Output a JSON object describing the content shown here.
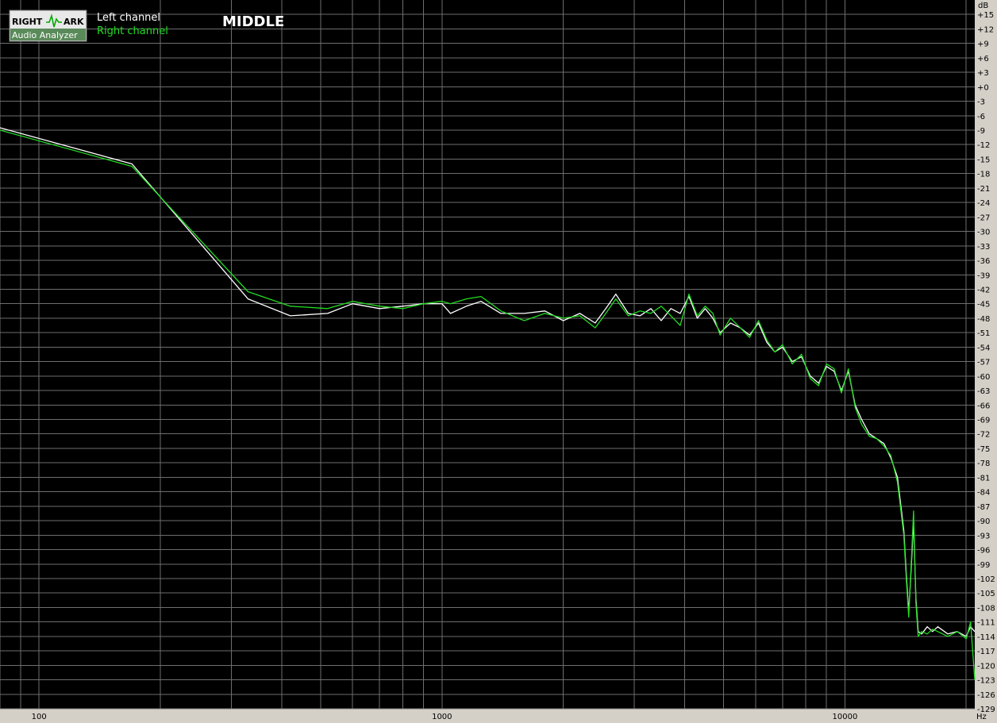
{
  "logo": {
    "word1": "RIGHT",
    "word2": "ARK",
    "subtitle": "Audio Analyzer"
  },
  "chart_data": {
    "type": "line",
    "title": "MIDDLE",
    "xlabel": "Hz",
    "ylabel": "dB",
    "x_scale": "log",
    "xlim": [
      80,
      21000
    ],
    "ylim": [
      -129,
      18
    ],
    "grid": true,
    "legend_position": "top-left",
    "x_tick_labels": [
      {
        "value": 100,
        "label": "100"
      },
      {
        "value": 1000,
        "label": "1000"
      },
      {
        "value": 10000,
        "label": "10000"
      }
    ],
    "y_tick_labels": [
      "+15",
      "+12",
      "+9",
      "+6",
      "+3",
      "+0",
      "-3",
      "-6",
      "-9",
      "-12",
      "-15",
      "-18",
      "-21",
      "-24",
      "-27",
      "-30",
      "-33",
      "-36",
      "-39",
      "-42",
      "-45",
      "-48",
      "-51",
      "-54",
      "-57",
      "-60",
      "-63",
      "-66",
      "-69",
      "-72",
      "-75",
      "-78",
      "-81",
      "-84",
      "-87",
      "-90",
      "-93",
      "-96",
      "-99",
      "-102",
      "-105",
      "-108",
      "-111",
      "-114",
      "-117",
      "-120",
      "-123",
      "-126",
      "-129"
    ],
    "y_tick_values": [
      15,
      12,
      9,
      6,
      3,
      0,
      -3,
      -6,
      -9,
      -12,
      -15,
      -18,
      -21,
      -24,
      -27,
      -30,
      -33,
      -36,
      -39,
      -42,
      -45,
      -48,
      -51,
      -54,
      -57,
      -60,
      -63,
      -66,
      -69,
      -72,
      -75,
      -78,
      -81,
      -84,
      -87,
      -90,
      -93,
      -96,
      -99,
      -102,
      -105,
      -108,
      -111,
      -114,
      -117,
      -120,
      -123,
      -126,
      -129
    ],
    "series": [
      {
        "name": "Left channel",
        "color": "#ffffff",
        "points": [
          [
            80,
            -8.5
          ],
          [
            170,
            -16
          ],
          [
            330,
            -44
          ],
          [
            420,
            -47.5
          ],
          [
            520,
            -47
          ],
          [
            600,
            -45
          ],
          [
            700,
            -46
          ],
          [
            800,
            -45.5
          ],
          [
            900,
            -45
          ],
          [
            1000,
            -45
          ],
          [
            1050,
            -47
          ],
          [
            1150,
            -45.5
          ],
          [
            1250,
            -44.5
          ],
          [
            1400,
            -47
          ],
          [
            1600,
            -47
          ],
          [
            1800,
            -46.5
          ],
          [
            2000,
            -48.5
          ],
          [
            2200,
            -47
          ],
          [
            2400,
            -49
          ],
          [
            2550,
            -46
          ],
          [
            2700,
            -43
          ],
          [
            2900,
            -47
          ],
          [
            3100,
            -47.5
          ],
          [
            3300,
            -46
          ],
          [
            3500,
            -48.5
          ],
          [
            3700,
            -46
          ],
          [
            3900,
            -47
          ],
          [
            4100,
            -43.5
          ],
          [
            4300,
            -48
          ],
          [
            4500,
            -46
          ],
          [
            4700,
            -48
          ],
          [
            4900,
            -51
          ],
          [
            5200,
            -49
          ],
          [
            5500,
            -50
          ],
          [
            5800,
            -51.5
          ],
          [
            6100,
            -49
          ],
          [
            6400,
            -53
          ],
          [
            6700,
            -55
          ],
          [
            7000,
            -54
          ],
          [
            7400,
            -57
          ],
          [
            7800,
            -56
          ],
          [
            8200,
            -60
          ],
          [
            8600,
            -61.5
          ],
          [
            9000,
            -58
          ],
          [
            9400,
            -59
          ],
          [
            9800,
            -63
          ],
          [
            10200,
            -59
          ],
          [
            10600,
            -66
          ],
          [
            11000,
            -69
          ],
          [
            11500,
            -72
          ],
          [
            12000,
            -73
          ],
          [
            12500,
            -74
          ],
          [
            13000,
            -77
          ],
          [
            13500,
            -81
          ],
          [
            14000,
            -92
          ],
          [
            14200,
            -101
          ],
          [
            14400,
            -109
          ],
          [
            14600,
            -100
          ],
          [
            14800,
            -90
          ],
          [
            15000,
            -106
          ],
          [
            15200,
            -113
          ],
          [
            15500,
            -113.5
          ],
          [
            16000,
            -112
          ],
          [
            16500,
            -113
          ],
          [
            17000,
            -112
          ],
          [
            18000,
            -113.5
          ],
          [
            19000,
            -113
          ],
          [
            20000,
            -114
          ],
          [
            20500,
            -112
          ],
          [
            21000,
            -113
          ]
        ]
      },
      {
        "name": "Right channel",
        "color": "#22dd22",
        "points": [
          [
            80,
            -9
          ],
          [
            170,
            -16.5
          ],
          [
            330,
            -42.5
          ],
          [
            420,
            -45.5
          ],
          [
            520,
            -46
          ],
          [
            600,
            -44.5
          ],
          [
            700,
            -45.5
          ],
          [
            800,
            -46
          ],
          [
            900,
            -45
          ],
          [
            1000,
            -44.5
          ],
          [
            1050,
            -45
          ],
          [
            1150,
            -44
          ],
          [
            1250,
            -43.5
          ],
          [
            1400,
            -46.5
          ],
          [
            1600,
            -48.5
          ],
          [
            1800,
            -47
          ],
          [
            2000,
            -48
          ],
          [
            2200,
            -47.5
          ],
          [
            2400,
            -50
          ],
          [
            2550,
            -47
          ],
          [
            2700,
            -44
          ],
          [
            2900,
            -47.5
          ],
          [
            3100,
            -46.5
          ],
          [
            3300,
            -47
          ],
          [
            3500,
            -45.5
          ],
          [
            3700,
            -47.5
          ],
          [
            3900,
            -49.5
          ],
          [
            4100,
            -43
          ],
          [
            4300,
            -47.5
          ],
          [
            4500,
            -45.5
          ],
          [
            4700,
            -47
          ],
          [
            4900,
            -51.5
          ],
          [
            5200,
            -48
          ],
          [
            5500,
            -50
          ],
          [
            5800,
            -52
          ],
          [
            6100,
            -48.5
          ],
          [
            6400,
            -52.5
          ],
          [
            6700,
            -55
          ],
          [
            7000,
            -53.5
          ],
          [
            7400,
            -57.5
          ],
          [
            7800,
            -55.5
          ],
          [
            8200,
            -60.5
          ],
          [
            8600,
            -62
          ],
          [
            9000,
            -57.5
          ],
          [
            9400,
            -58.5
          ],
          [
            9800,
            -63.5
          ],
          [
            10200,
            -58.5
          ],
          [
            10600,
            -66.5
          ],
          [
            11000,
            -70
          ],
          [
            11500,
            -72.5
          ],
          [
            12000,
            -73
          ],
          [
            12500,
            -74.5
          ],
          [
            13000,
            -76.5
          ],
          [
            13500,
            -82
          ],
          [
            14000,
            -93
          ],
          [
            14200,
            -102
          ],
          [
            14400,
            -110
          ],
          [
            14600,
            -99
          ],
          [
            14800,
            -88
          ],
          [
            15000,
            -107
          ],
          [
            15200,
            -114
          ],
          [
            15500,
            -113
          ],
          [
            16000,
            -113.5
          ],
          [
            16500,
            -112.5
          ],
          [
            17000,
            -113
          ],
          [
            18000,
            -114
          ],
          [
            19000,
            -113
          ],
          [
            20000,
            -114.5
          ],
          [
            20500,
            -111
          ],
          [
            21000,
            -123
          ]
        ]
      }
    ]
  }
}
